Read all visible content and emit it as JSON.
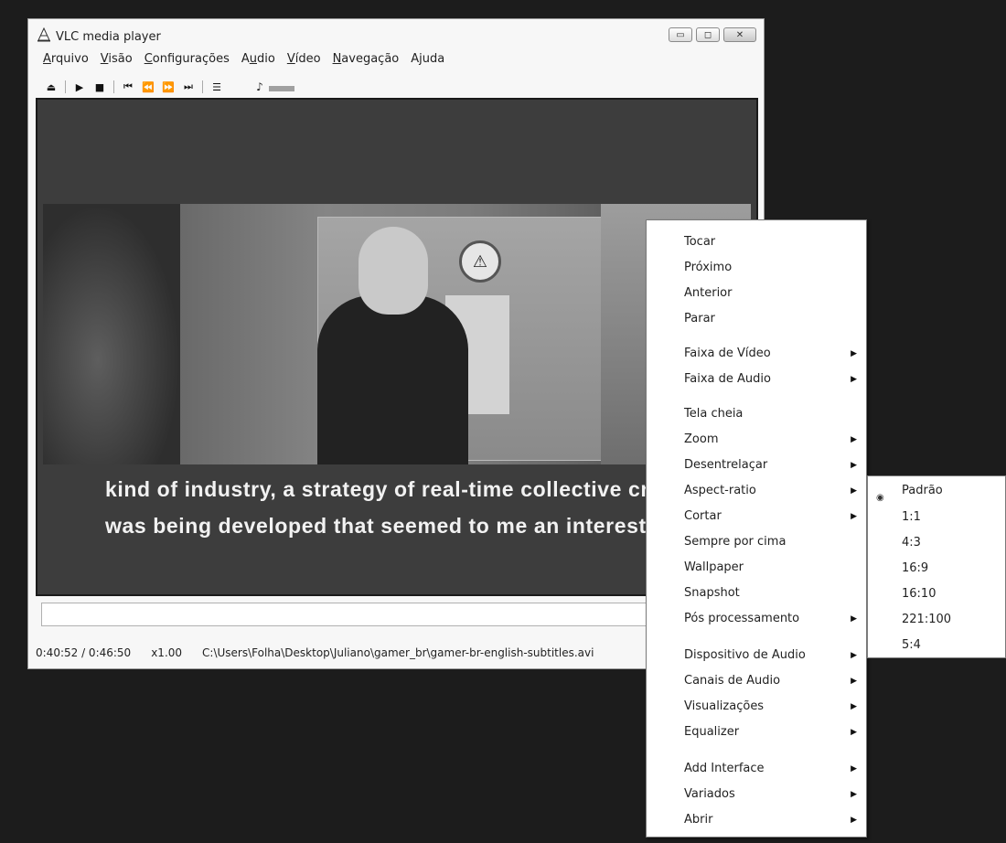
{
  "window": {
    "title": "VLC media player",
    "controls": {
      "minimize": "▭",
      "maximize": "◻",
      "close": "✕"
    }
  },
  "menubar": [
    {
      "label": "Arquivo",
      "u": "A",
      "rest": "rquivo"
    },
    {
      "label": "Visão",
      "u": "V",
      "rest": "isão"
    },
    {
      "label": "Configurações",
      "u": "C",
      "rest": "onfigurações"
    },
    {
      "label": "Audio",
      "u": "A",
      "rest": "udio",
      "pre": "A",
      "mid": "u",
      "post": "dio"
    },
    {
      "label": "Vídeo",
      "u": "V",
      "rest": "ídeo"
    },
    {
      "label": "Navegação",
      "u": "N",
      "rest": "avegação"
    },
    {
      "label": "Ajuda",
      "u": "",
      "rest": "Ajuda"
    }
  ],
  "toolbar": {
    "icons": [
      "eject-icon",
      "play-icon",
      "stop-icon",
      "prev-icon",
      "rewind-icon",
      "forward-icon",
      "next-icon",
      "playlist-icon",
      "volume-icon"
    ]
  },
  "video": {
    "subtitle_line1": "kind of industry, a strategy of real-time collective cre",
    "subtitle_line2": "was being developed that seemed to me an interest"
  },
  "status": {
    "time": "0:40:52 / 0:46:50",
    "speed": "x1.00",
    "path": "C:\\Users\\Folha\\Desktop\\Juliano\\gamer_br\\gamer-br-english-subtitles.avi"
  },
  "context_menu": [
    {
      "label": "Tocar",
      "submenu": false
    },
    {
      "label": "Próximo",
      "submenu": false
    },
    {
      "label": "Anterior",
      "submenu": false
    },
    {
      "label": "Parar",
      "submenu": false
    },
    {
      "label": "Faixa de Vídeo",
      "submenu": true
    },
    {
      "label": "Faixa de Audio",
      "submenu": true
    },
    {
      "label": "Tela cheia",
      "submenu": false
    },
    {
      "label": "Zoom",
      "submenu": true
    },
    {
      "label": "Desentrelaçar",
      "submenu": true
    },
    {
      "label": "Aspect-ratio",
      "submenu": true
    },
    {
      "label": "Cortar",
      "submenu": true
    },
    {
      "label": "Sempre por cima",
      "submenu": false
    },
    {
      "label": "Wallpaper",
      "submenu": false
    },
    {
      "label": "Snapshot",
      "submenu": false
    },
    {
      "label": "Pós processamento",
      "submenu": true
    },
    {
      "label": "Dispositivo de Audio",
      "submenu": true
    },
    {
      "label": "Canais de Audio",
      "submenu": true
    },
    {
      "label": "Visualizações",
      "submenu": true
    },
    {
      "label": "Equalizer",
      "submenu": true
    },
    {
      "label": "Add Interface",
      "submenu": true
    },
    {
      "label": "Variados",
      "submenu": true
    },
    {
      "label": "Abrir",
      "submenu": true
    }
  ],
  "aspect_submenu": {
    "selected": "Padrão",
    "items": [
      "Padrão",
      "1:1",
      "4:3",
      "16:9",
      "16:10",
      "221:100",
      "5:4"
    ]
  }
}
